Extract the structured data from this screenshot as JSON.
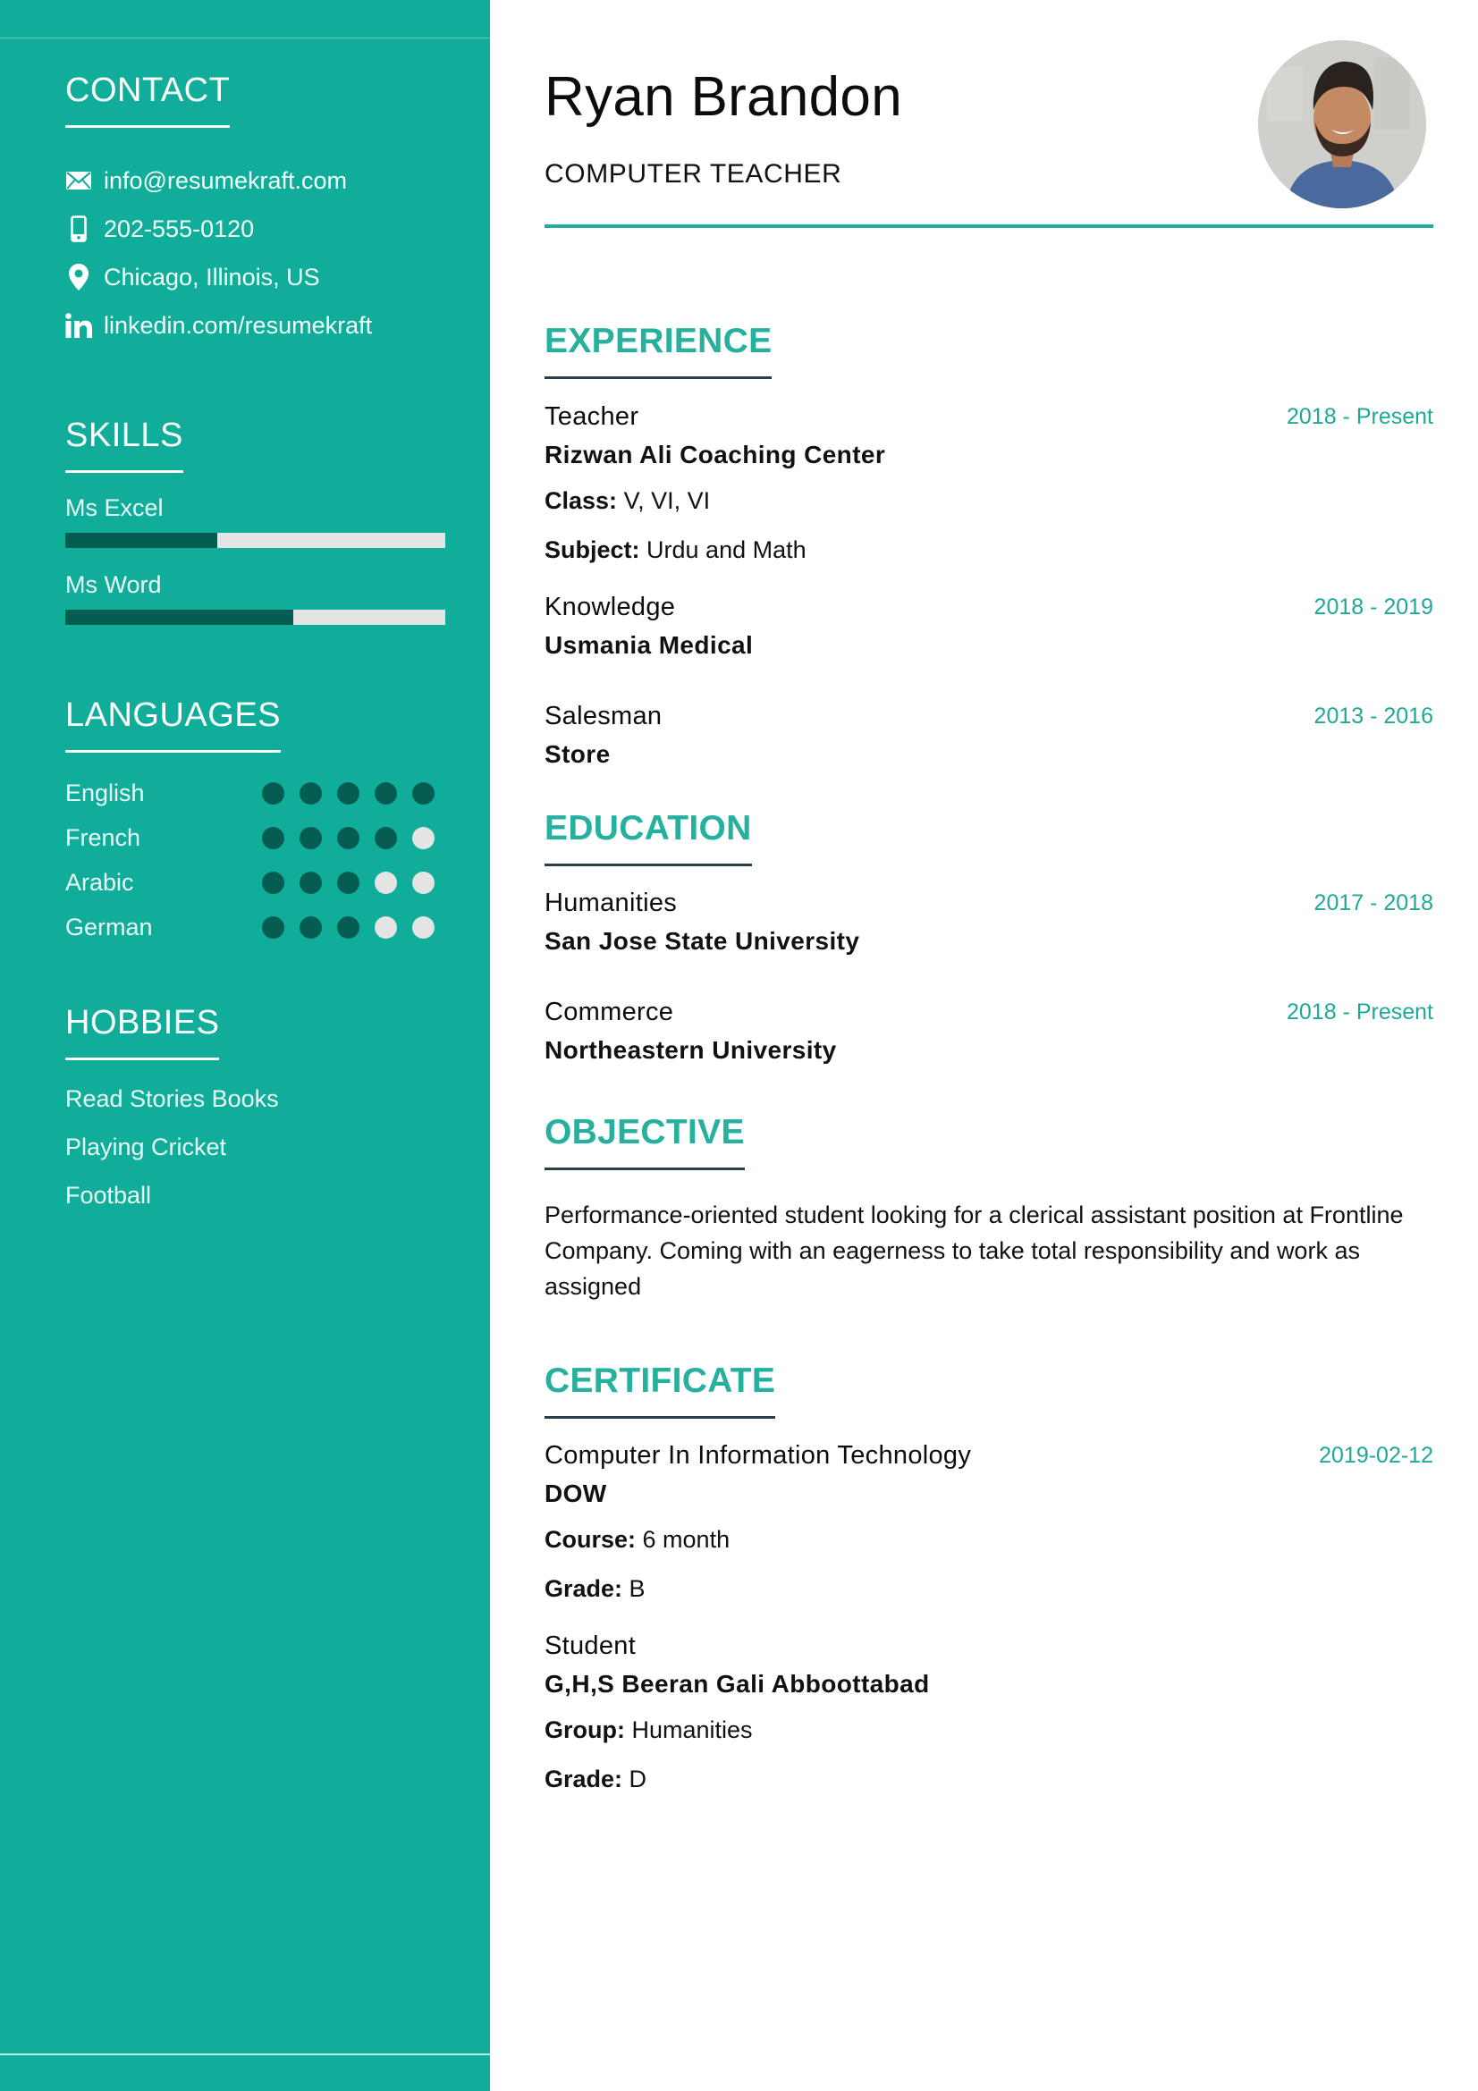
{
  "colors": {
    "sidebar_bg": "#10ae9a",
    "accent": "#26b09e",
    "bar_fill": "#055c50",
    "bar_track": "#e4e4e4"
  },
  "contact": {
    "heading": "CONTACT",
    "items": [
      {
        "icon": "envelope-icon",
        "text": "info@resumekraft.com"
      },
      {
        "icon": "phone-icon",
        "text": "202-555-0120"
      },
      {
        "icon": "location-pin-icon",
        "text": "Chicago, Illinois, US"
      },
      {
        "icon": "linkedin-icon",
        "text": "linkedin.com/resumekraft"
      }
    ]
  },
  "skills": {
    "heading": "SKILLS",
    "items": [
      {
        "label": "Ms Excel",
        "level": 0.4
      },
      {
        "label": "Ms Word",
        "level": 0.6
      }
    ]
  },
  "languages": {
    "heading": "LANGUAGES",
    "max": 5,
    "items": [
      {
        "name": "English",
        "level": 5
      },
      {
        "name": "French",
        "level": 4
      },
      {
        "name": "Arabic",
        "level": 3
      },
      {
        "name": "German",
        "level": 3
      }
    ]
  },
  "hobbies": {
    "heading": "HOBBIES",
    "items": [
      "Read Stories Books",
      "Playing Cricket",
      "Football"
    ]
  },
  "header": {
    "name": "Ryan Brandon",
    "role": "COMPUTER TEACHER",
    "photo_alt": "profile-photo"
  },
  "experience": {
    "heading": "EXPERIENCE",
    "items": [
      {
        "title": "Teacher",
        "org": "Rizwan Ali Coaching Center",
        "date": "2018 - Present",
        "details": [
          {
            "label": "Class:",
            "value": "V, VI, VI"
          },
          {
            "label": "Subject:",
            "value": "Urdu and Math"
          }
        ]
      },
      {
        "title": "Knowledge",
        "org": "Usmania Medical",
        "date": "2018 - 2019"
      },
      {
        "title": "Salesman",
        "org": "Store",
        "date": "2013 - 2016"
      }
    ]
  },
  "education": {
    "heading": "EDUCATION",
    "items": [
      {
        "title": "Humanities",
        "org": "San Jose State University",
        "date": "2017 - 2018"
      },
      {
        "title": "Commerce",
        "org": "Northeastern University",
        "date": "2018 - Present"
      }
    ]
  },
  "objective": {
    "heading": "OBJECTIVE",
    "text": "Performance-oriented student looking for a clerical assistant position at Frontline Company. Coming with an eagerness to take total responsibility and work as assigned"
  },
  "certificate": {
    "heading": "CERTIFICATE",
    "items": [
      {
        "title": "Computer In Information Technology",
        "org": "DOW",
        "date": "2019-02-12",
        "details": [
          {
            "label": "Course:",
            "value": "6 month"
          },
          {
            "label": "Grade:",
            "value": "B"
          }
        ]
      },
      {
        "title": "Student",
        "org": "G,H,S Beeran Gali Abboottabad",
        "details": [
          {
            "label": "Group:",
            "value": "Humanities"
          },
          {
            "label": "Grade:",
            "value": "D"
          }
        ]
      }
    ]
  }
}
